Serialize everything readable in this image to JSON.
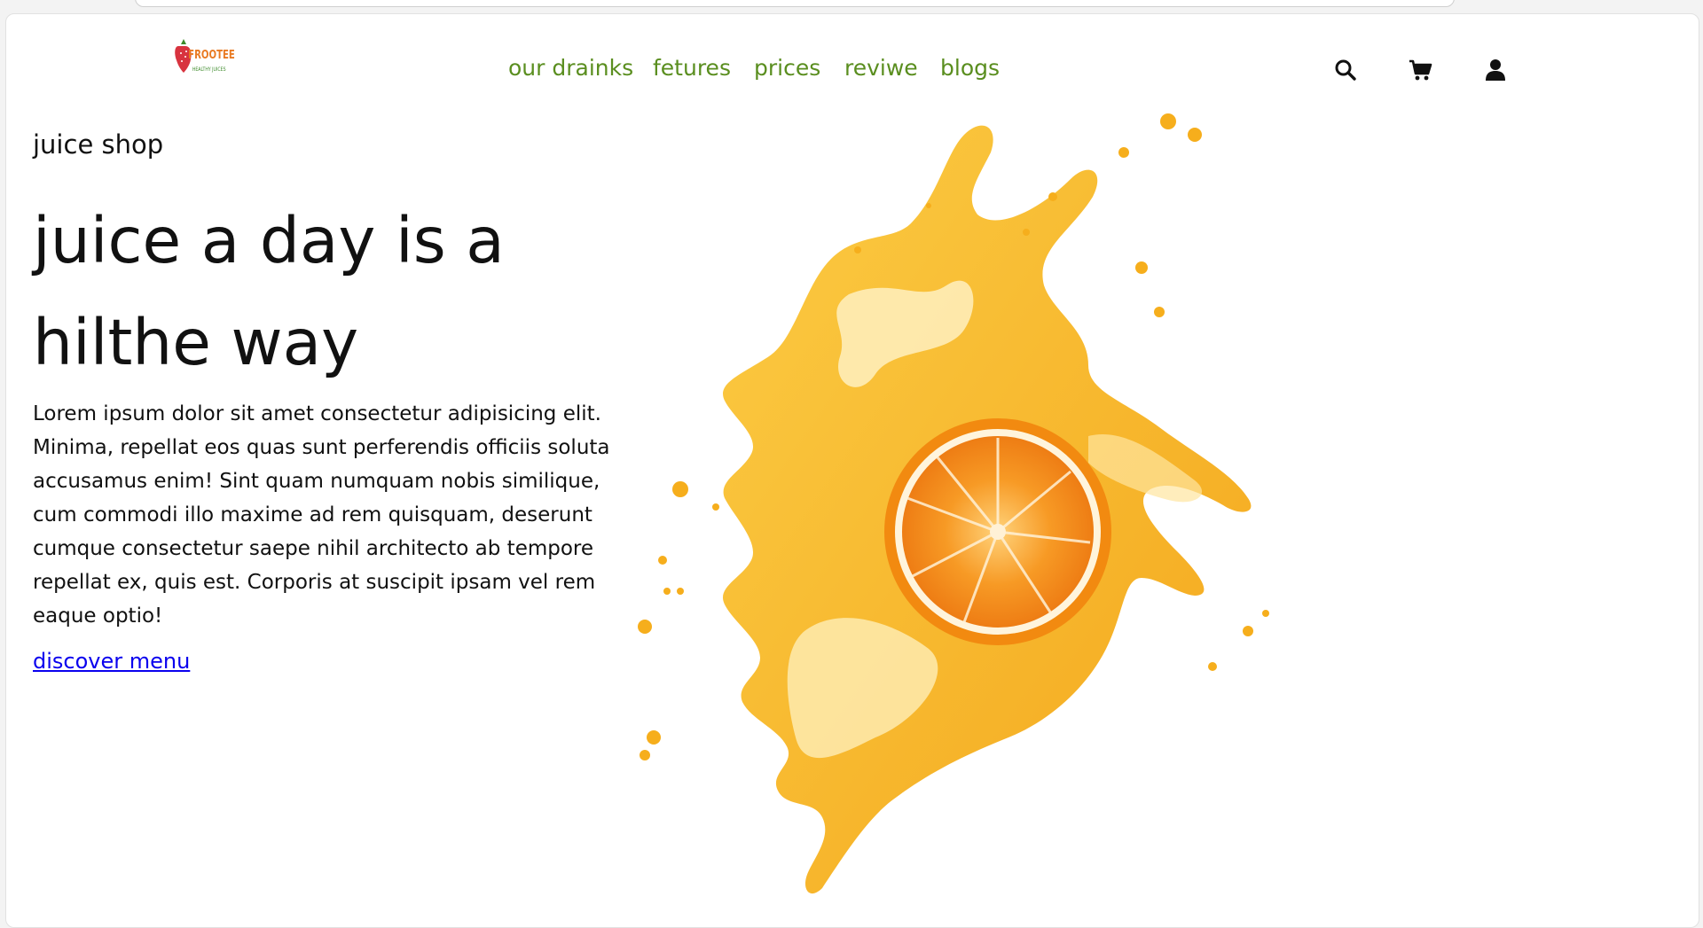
{
  "brand": {
    "logo_text": "FROOTEE",
    "logo_subtext": "HEALTHY JUICES"
  },
  "nav": {
    "items": [
      "our drainks",
      "fetures",
      "prices",
      "reviwe",
      "blogs"
    ]
  },
  "header_icons": [
    "search-icon",
    "cart-icon",
    "user-icon"
  ],
  "hero": {
    "tagline": "juice shop",
    "headline_line1": "juice a day is a",
    "headline_line2": "hilthe way",
    "description": "Lorem ipsum dolor sit amet consectetur adipisicing elit. Minima, repellat eos quas sunt perferendis officiis soluta accusamus enim! Sint quam numquam nobis similique, cum commodi illo maxime ad rem quisquam, deserunt cumque consectetur saepe nihil architecto ab tempore repellat ex, quis est. Corporis at suscipit ipsam vel rem eaque optio!",
    "cta_label": "discover menu"
  },
  "colors": {
    "nav_link": "#5a8e1f",
    "cta_link": "#0a00ee",
    "juice": "#f7b320",
    "orange": "#f58a1f"
  }
}
